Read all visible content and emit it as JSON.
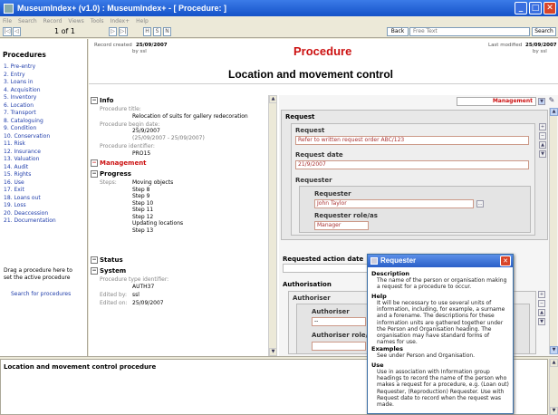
{
  "window": {
    "title": "MuseumIndex+ (v1.0) : MuseumIndex+ - [ Procedure: ]",
    "minimize": "_",
    "maximize": "□",
    "close": "✕"
  },
  "menu": [
    "File",
    "Search",
    "Record",
    "Views",
    "Tools",
    "Index+",
    "Help"
  ],
  "toolbar": {
    "record_counter": "1 of 1",
    "first": "|◁",
    "prev": "◁",
    "next": "▷",
    "last": "▷|",
    "h_btn": "H",
    "s_btn": "S",
    "n_btn": "N",
    "back_label": "Back",
    "free_text_placeholder": "Free Text",
    "search_label": "Search"
  },
  "sidebar": {
    "title": "Procedures",
    "items": [
      "1. Pre-entry",
      "2. Entry",
      "3. Loans in",
      "4. Acquisition",
      "5. Inventory",
      "6. Location",
      "7. Transport",
      "8. Cataloguing",
      "9. Condition",
      "10. Conservation",
      "11. Risk",
      "12. Insurance",
      "13. Valuation",
      "14. Audit",
      "15. Rights",
      "16. Use",
      "17. Exit",
      "18. Loans out",
      "19. Loss",
      "20. Deaccession",
      "21. Documentation"
    ],
    "drag_hint": "Drag a procedure here to set the active procedure",
    "search_link": "Search for procedures"
  },
  "header": {
    "record_created_label": "Record created",
    "record_created_date": "25/09/2007",
    "record_created_by": "by ssl",
    "title": "Procedure",
    "last_modified_label": "Last modified",
    "last_modified_date": "25/09/2007",
    "last_modified_by": "by ssl",
    "subtitle": "Location and movement control"
  },
  "info": {
    "section_title": "Info",
    "expand_icon": "−",
    "procedure_title_label": "Procedure title:",
    "procedure_title_value": "Relocation of suits for gallery redecoration",
    "begin_date_label": "Procedure begin date:",
    "begin_date_value": "25/9/2007",
    "begin_date_range": "(25/09/2007 - 25/09/2007)",
    "identifier_label": "Procedure identifier:",
    "identifier_value": "PRO15",
    "management_title": "Management",
    "progress_title": "Progress",
    "steps_label": "Steps:",
    "steps": [
      "Moving objects",
      "Step 8",
      "Step 9",
      "Step 10",
      "Step 11",
      "Step 12",
      "Updating locations",
      "Step 13"
    ],
    "status_title": "Status",
    "system_title": "System",
    "type_identifier_label": "Procedure type identifier:",
    "type_identifier_value": "AUTH37",
    "edited_by_label": "Edited by:",
    "edited_by_value": "ssl",
    "edited_on_label": "Edited on:",
    "edited_on_value": "25/09/2007"
  },
  "form": {
    "view_selector": "Management",
    "request_title": "Request",
    "request_label": "Request",
    "request_value": "Refer to written request order ABC/123",
    "request_date_label": "Request date",
    "request_date_value": "21/9/2007",
    "requester_title": "Requester",
    "requester_label": "Requester",
    "requester_value": "John Taylor",
    "requester_role_label": "Requester role/as",
    "requester_role_value": "Manager",
    "requested_action_date_label": "Requested action date",
    "authorisation_title": "Authorisation",
    "authoriser_title": "Authoriser",
    "authoriser_label": "Authoriser",
    "authoriser_value": "--",
    "authoriser_role_label": "Authoriser role/as"
  },
  "tooltip": {
    "title": "Requester",
    "close": "✕",
    "description_heading": "Description",
    "description_text": "The name of the person or organisation making a request for a procedure to occur.",
    "help_heading": "Help",
    "help_text": "It will be necessary to use several units of information, including, for example, a surname and a forename. The descriptions for these information units are gathered together under the Person and Organisation heading. The organisation may have standard forms of names for use.",
    "examples_heading": "Examples",
    "examples_text": "See under Person and Organisation.",
    "use_heading": "Use",
    "use_text": "Use in association with Information group headings to record the name of the person who makes a request for a procedure, e.g. (Loan out) Requester, (Reproduction) Requester. Use with Request date to record when the request was made."
  },
  "footer": {
    "description": "Location and movement control procedure"
  },
  "colors": {
    "title_bar": "#1552c8",
    "accent_red": "#cc1111",
    "link_blue": "#1e3caa"
  }
}
